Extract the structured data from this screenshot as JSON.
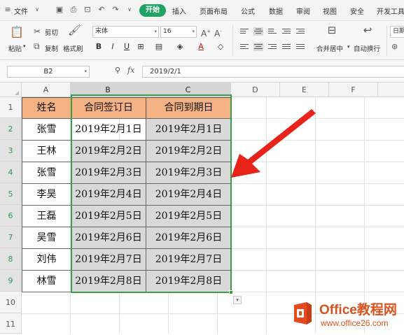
{
  "menu": {
    "file_label": "文件",
    "tabs": [
      "开始",
      "插入",
      "页面布局",
      "公式",
      "数据",
      "审阅",
      "视图",
      "安全",
      "开发工具"
    ],
    "active_tab": "开始"
  },
  "ribbon": {
    "paste_label": "粘贴",
    "cut_label": "剪切",
    "copy_label": "复制",
    "format_painter_label": "格式刷",
    "font_name": "宋体",
    "font_size": "16",
    "merge_label": "合并居中",
    "wrap_label": "自动换行",
    "right_label": "日期"
  },
  "formula_bar": {
    "name_box": "B2",
    "fx_label": "fx",
    "formula_value": "2019/2/1"
  },
  "grid": {
    "columns": [
      "A",
      "B",
      "C",
      "D",
      "E",
      "F"
    ],
    "rows": [
      "1",
      "2",
      "3",
      "4",
      "5",
      "6",
      "7",
      "8",
      "9",
      "10",
      "11"
    ],
    "header": [
      "姓名",
      "合同签订日",
      "合同到期日"
    ],
    "data": [
      [
        "张雪",
        "2019年2月1日",
        "2019年2月1日"
      ],
      [
        "王林",
        "2019年2月2日",
        "2019年2月2日"
      ],
      [
        "张雪",
        "2019年2月3日",
        "2019年2月3日"
      ],
      [
        "李昊",
        "2019年2月4日",
        "2019年2月4日"
      ],
      [
        "王磊",
        "2019年2月5日",
        "2019年2月5日"
      ],
      [
        "吴雪",
        "2019年2月6日",
        "2019年2月6日"
      ],
      [
        "刘伟",
        "2019年2月7日",
        "2019年2月7日"
      ],
      [
        "林雪",
        "2019年2月8日",
        "2019年2月8日"
      ]
    ]
  },
  "watermark": {
    "title": "Office教程网",
    "url": "www.office26.com"
  },
  "colors": {
    "accent_green": "#21a366",
    "header_fill": "#f4b183",
    "arrow_red": "#e8231a",
    "watermark_orange": "#d9531e"
  }
}
